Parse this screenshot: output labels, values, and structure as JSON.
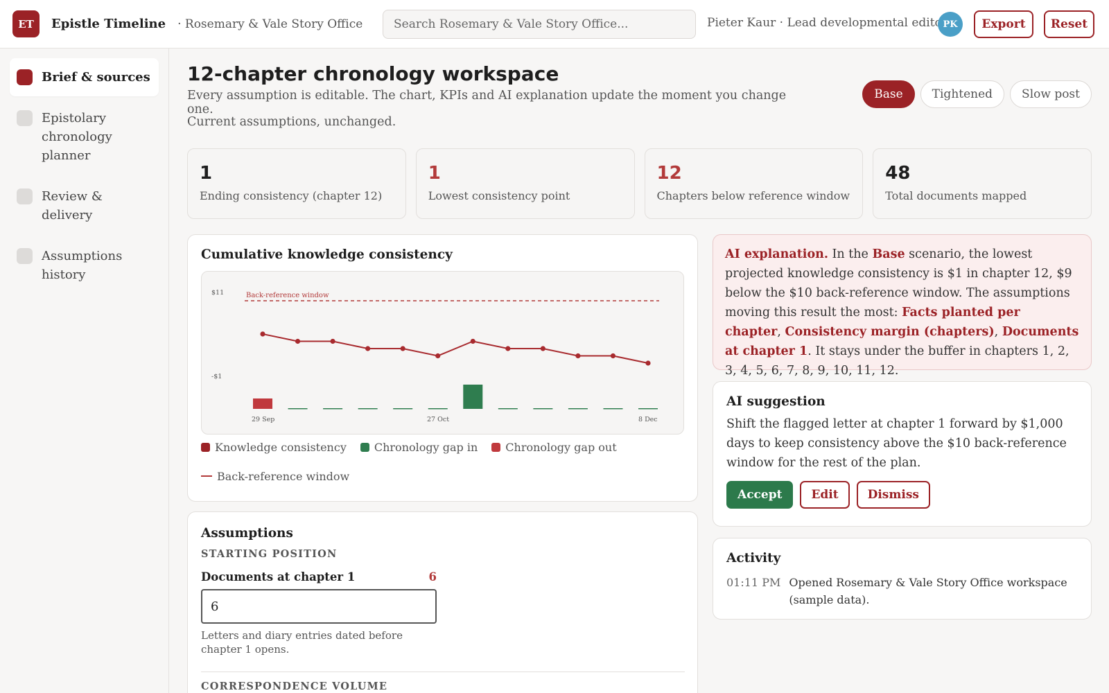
{
  "header": {
    "logo_initials": "ET",
    "app_title": "Epistle Timeline",
    "org": "· Rosemary & Vale Story Office",
    "search_placeholder": "Search Rosemary & Vale Story Office...",
    "user": "Pieter Kaur · Lead developmental editor",
    "avatar_initials": "PK",
    "export_label": "Export",
    "reset_label": "Reset"
  },
  "sidebar": {
    "items": [
      {
        "label": "Brief & sources",
        "active": true
      },
      {
        "label": "Epistolary chronology planner",
        "active": false
      },
      {
        "label": "Review & delivery",
        "active": false
      },
      {
        "label": "Assumptions history",
        "active": false
      }
    ]
  },
  "main": {
    "title": "12-chapter chronology workspace",
    "subtitle": "Every assumption is editable. The chart, KPIs and AI explanation update the moment you change one.",
    "status": "Current assumptions, unchanged.",
    "scenarios": [
      {
        "label": "Base",
        "active": true
      },
      {
        "label": "Tightened",
        "active": false
      },
      {
        "label": "Slow post",
        "active": false
      }
    ]
  },
  "kpis": [
    {
      "value": "1",
      "label": "Ending consistency (chapter 12)",
      "highlight": false
    },
    {
      "value": "1",
      "label": "Lowest consistency point",
      "highlight": true
    },
    {
      "value": "12",
      "label": "Chapters below reference window",
      "highlight": true
    },
    {
      "value": "48",
      "label": "Total documents mapped",
      "highlight": false
    }
  ],
  "chart": {
    "title": "Cumulative knowledge consistency",
    "legend": {
      "consistency": "Knowledge consistency",
      "gap_in": "Chronology gap in",
      "gap_out": "Chronology gap out",
      "window": "Back-reference window"
    }
  },
  "chart_data": {
    "type": "line",
    "x_tick_labels": [
      "27 Oct",
      "8 Dec"
    ],
    "first_tick_label": "29 Sep",
    "y_tick_labels": [
      "$11",
      "-$1"
    ],
    "ylim": [
      -1,
      11
    ],
    "window": {
      "label": "Back-reference window",
      "value": 11
    },
    "series": [
      {
        "name": "Knowledge consistency",
        "type": "line",
        "values": [
          6,
          5,
          5,
          4,
          4,
          3,
          5,
          4,
          4,
          3,
          3,
          2
        ]
      },
      {
        "name": "Chronology gap in",
        "type": "bar",
        "values": [
          0,
          0,
          0,
          0,
          0,
          0,
          3.5,
          0,
          0,
          0,
          0,
          0
        ]
      },
      {
        "name": "Chronology gap out",
        "type": "bar",
        "values": [
          1.5,
          0,
          0,
          0,
          0,
          0,
          0,
          0,
          0,
          0,
          0,
          0
        ]
      }
    ],
    "colors": {
      "consistency": "#a82a2e",
      "gap_in": "#2f7d4f",
      "gap_out": "#c0393d",
      "window": "#b23a3a"
    }
  },
  "ai_explanation": {
    "lead": "AI explanation.",
    "t1": " In the ",
    "scenario": "Base",
    "t2": " scenario, the lowest projected knowledge consistency is $1 in chapter 12, $9 below the $10 back-reference window. The assumptions moving this result the most: ",
    "f1": "Facts planted per chapter",
    "c1": ", ",
    "f2": "Consistency margin (chapters)",
    "c2": ", ",
    "f3": "Documents at chapter 1",
    "t3": ". It stays under the buffer in chapters 1, 2, 3, 4, 5, 6, 7, 8, 9, 10, 11, 12."
  },
  "suggestion": {
    "title": "AI suggestion",
    "text": "Shift the flagged letter at chapter 1 forward by $1,000 days to keep consistency above the $10 back-reference window for the rest of the plan.",
    "accept": "Accept",
    "edit": "Edit",
    "dismiss": "Dismiss"
  },
  "activity": {
    "title": "Activity",
    "items": [
      {
        "time": "01:11 PM",
        "text": "Opened Rosemary & Vale Story Office workspace (sample data)."
      }
    ]
  },
  "assumptions": {
    "title": "Assumptions",
    "section1": "STARTING POSITION",
    "field_label": "Documents at chapter 1",
    "field_display": "6",
    "field_value": "6",
    "help": "Letters and diary entries dated before chapter 1 opens.",
    "section2": "CORRESPONDENCE VOLUME"
  }
}
